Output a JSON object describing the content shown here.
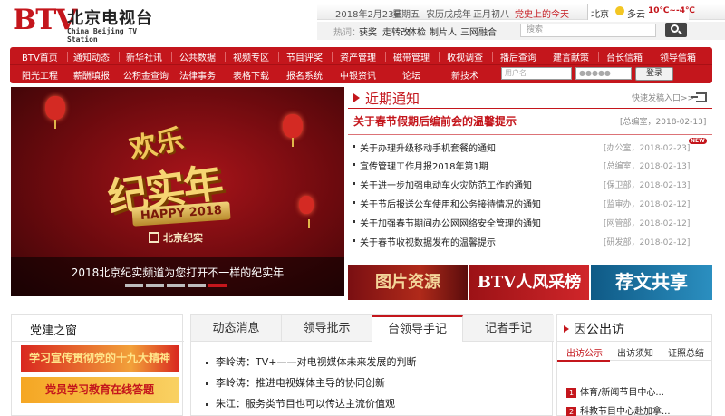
{
  "header": {
    "logo_btv": "BTV",
    "logo_cn": "北京电视台",
    "logo_en": "China Beijing TV Station",
    "date": "2018年2月23日",
    "weekday": "星期五",
    "lunar_year": "农历戊戌年",
    "lunar_day": "正月初八",
    "party_link": "党史上的今天",
    "weather_city": "北京",
    "weather_icon": "sun-cloud-icon",
    "weather_text": "多云",
    "weather_temp": "10℃~-4℃",
    "hot_label": "热词：",
    "hot_words": [
      "获奖",
      "走转改",
      "体检",
      "制片人",
      "三网融合"
    ],
    "search_placeholder": "搜索",
    "search_icon": "search-icon"
  },
  "nav": {
    "row1": [
      "BTV首页",
      "通知动态",
      "新华社讯",
      "公共数据",
      "视频专区",
      "节目评奖",
      "资产管理",
      "磁带管理",
      "收视调查",
      "播后查询",
      "建言献策",
      "台长信箱",
      "领导信箱"
    ],
    "row2": [
      "阳光工程",
      "薪酬填报",
      "公积金查询",
      "法律事务",
      "表格下载",
      "报名系统",
      "中银资讯",
      "论坛",
      "新技术"
    ],
    "username_placeholder": "用户名",
    "password_placeholder": "●●●●●",
    "login_label": "登录"
  },
  "hero": {
    "art_line1": "欢乐",
    "art_line2": "纪实年",
    "art_happy": "HAPPY 2018",
    "art_brand": "北京纪实",
    "caption": "2018北京纪实频道为您打开不一样的纪实年",
    "slide_count": 5,
    "active_slide": 5
  },
  "notices": {
    "title": "近期通知",
    "quick_login": "快速发稿入口>>",
    "headline": "关于春节假期后编前会的温馨提示",
    "headline_meta": "[总编室，2018-02-13]",
    "items": [
      {
        "text": "关于办理升级移动手机套餐的通知",
        "meta": "[办公室，2018-02-23]",
        "new": "NEW"
      },
      {
        "text": "宣传管理工作月报2018年第1期",
        "meta": "[总编室，2018-02-13]",
        "new": ""
      },
      {
        "text": "关于进一步加强电动车火灾防范工作的通知",
        "meta": "[保卫部，2018-02-13]",
        "new": ""
      },
      {
        "text": "关于节后报送公车使用和公务接待情况的通知",
        "meta": "[监审办，2018-02-12]",
        "new": ""
      },
      {
        "text": "关于加强春节期间办公网网络安全管理的通知",
        "meta": "[网管部，2018-02-12]",
        "new": ""
      },
      {
        "text": "关于春节收视数据发布的温馨提示",
        "meta": "[研发部，2018-02-12]",
        "new": ""
      }
    ]
  },
  "banners": [
    "图片资源",
    "BTV人风采榜",
    "荐文共享"
  ],
  "party": {
    "title": "党建之窗",
    "banner1": "学习宣传贯彻党的十九大精神",
    "banner2": "党员学习教育在线答题"
  },
  "tabs": {
    "labels": [
      "动态消息",
      "领导批示",
      "台领导手记",
      "记者手记"
    ],
    "active_index": 2,
    "items": [
      "李岭涛：TV+——对电视媒体未来发展的判断",
      "李岭涛：推进电视媒体主导的协同创新",
      "朱江：服务类节目也可以传达主流价值观"
    ]
  },
  "visit": {
    "title": "因公出访",
    "tabs": [
      "出访公示",
      "出访须知",
      "证照总结"
    ],
    "items": [
      {
        "num": "1",
        "text": "体育/新闻节目中心..."
      },
      {
        "num": "2",
        "text": "科教节目中心赴加拿..."
      }
    ]
  },
  "colors": {
    "brand_red": "#c4161c",
    "nav_text": "#ffffff",
    "meta_gray": "#999999"
  }
}
